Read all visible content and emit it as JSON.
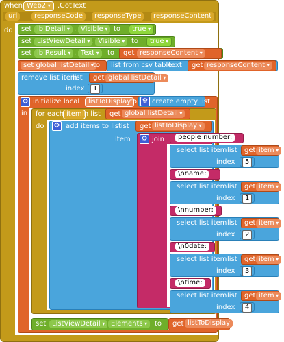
{
  "event": {
    "when": "when",
    "component": "Web2",
    "event_name": ".GotText",
    "params": [
      "url",
      "responseCode",
      "responseType",
      "responseContent"
    ],
    "do": "do"
  },
  "stmt1": {
    "set": "set",
    "component": "lblDetail",
    "dot": ".",
    "prop": "Visible",
    "to": "to",
    "value": "true"
  },
  "stmt2": {
    "set": "set",
    "component": "ListViewDetail",
    "dot": ".",
    "prop": "Visible",
    "to": "to",
    "value": "true"
  },
  "stmt3": {
    "set": "set",
    "component": "lblResult",
    "dot": ".",
    "prop": "Text",
    "to": "to",
    "get": "get",
    "var": "responseContent"
  },
  "stmt4": {
    "set": "set global listDetail",
    "to": "to",
    "csv": "list from csv table",
    "text": "text",
    "get": "get",
    "var": "responseContent"
  },
  "stmt5": {
    "remove": "remove list item",
    "list": "list",
    "get": "get",
    "var": "global listDetail",
    "index": "index",
    "index_val": "1"
  },
  "local": {
    "init": "initialize local",
    "var": "listToDisplay",
    "to": "to",
    "empty": "create empty list",
    "in": "in"
  },
  "foreach": {
    "for_each": "for each",
    "item": "item",
    "in_list": "in list",
    "get": "get",
    "var": "global listDetail",
    "do": "do"
  },
  "additems": {
    "label": "add items to list",
    "list": "list",
    "get": "get",
    "var": "listToDisplay",
    "item": "item"
  },
  "join": {
    "label": "join"
  },
  "join_parts": [
    {
      "text": "people number:",
      "select": "select list item",
      "list": "list",
      "get": "get",
      "var": "item",
      "index": "index",
      "index_val": "5"
    },
    {
      "text": "\\nname:",
      "select": "select list item",
      "list": "list",
      "get": "get",
      "var": "item",
      "index": "index",
      "index_val": "1"
    },
    {
      "text": "\\nnumber:",
      "select": "select list item",
      "list": "list",
      "get": "get",
      "var": "item",
      "index": "index",
      "index_val": "2"
    },
    {
      "text": "\\n0date:",
      "select": "select list item",
      "list": "list",
      "get": "get",
      "var": "item",
      "index": "index",
      "index_val": "3"
    },
    {
      "text": "\\ntime:",
      "select": "select list item",
      "list": "list",
      "get": "get",
      "var": "item",
      "index": "index",
      "index_val": "4"
    }
  ],
  "stmt_last": {
    "set": "set",
    "component": "ListViewDetail",
    "dot": ".",
    "prop": "Elements",
    "to": "to",
    "get": "get",
    "var": "listToDisplay"
  },
  "colors": {
    "event": "#c39a1a",
    "component": "#6fae2a",
    "variable": "#e0642a",
    "list": "#4aa5dc",
    "text": "#c42b67",
    "control": "#c39a1a"
  }
}
